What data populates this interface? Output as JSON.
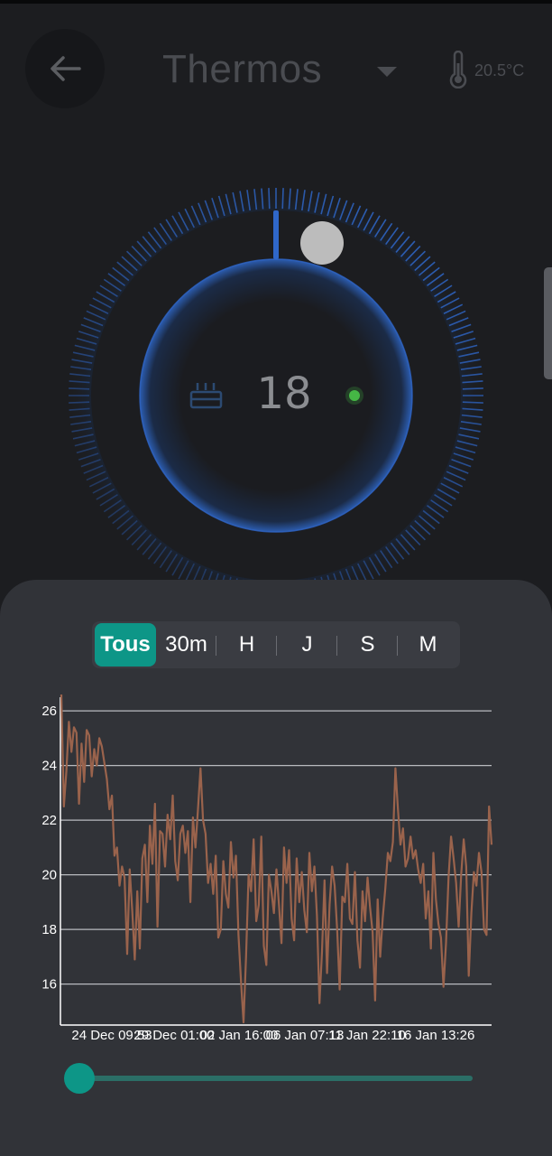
{
  "header": {
    "title": "Thermos",
    "back_icon": "arrow-left-icon",
    "dropdown_icon": "caret-down-icon",
    "thermometer_icon": "thermometer-icon",
    "external_temperature": "20.5°C"
  },
  "dial": {
    "setpoint": "18",
    "mode_icon": "radiator-icon",
    "status_dot_color": "#3fae3f",
    "accent_color": "#2f67c9"
  },
  "chart_tabs": {
    "items": [
      {
        "label": "Tous",
        "active": true
      },
      {
        "label": "30m",
        "active": false
      },
      {
        "label": "H",
        "active": false
      },
      {
        "label": "J",
        "active": false
      },
      {
        "label": "S",
        "active": false
      },
      {
        "label": "M",
        "active": false
      }
    ],
    "active_color": "#0d9687"
  },
  "chart_data": {
    "type": "line",
    "title": "",
    "xlabel": "",
    "ylabel": "",
    "ylim": [
      14.5,
      26.5
    ],
    "yticks": [
      16,
      18,
      20,
      22,
      24,
      26
    ],
    "xtick_labels": [
      "24 Dec 09:53",
      "29 Dec 01:00",
      "02 Jan 16:00",
      "06 Jan 07:13",
      "11 Jan 22:10",
      "16 Jan 13:26"
    ],
    "grid": true,
    "series": [
      {
        "name": "",
        "color": "#9a634c",
        "values": [
          26.6,
          22.5,
          23.8,
          25.6,
          24.5,
          25.4,
          25.2,
          22.6,
          24.8,
          23.4,
          25.3,
          25.1,
          23.6,
          24.6,
          24.0,
          25.0,
          24.7,
          24.1,
          23.5,
          22.4,
          22.9,
          20.7,
          21.0,
          19.6,
          20.3,
          19.9,
          17.1,
          20.2,
          18.7,
          16.9,
          19.4,
          17.3,
          20.6,
          21.1,
          19.0,
          21.8,
          20.4,
          22.6,
          18.1,
          21.6,
          21.5,
          20.3,
          22.2,
          21.3,
          22.9,
          20.5,
          19.8,
          21.5,
          21.8,
          20.8,
          21.6,
          19.0,
          22.1,
          21.0,
          22.4,
          23.9,
          22.0,
          21.5,
          19.7,
          20.4,
          19.3,
          20.7,
          17.7,
          18.0,
          20.5,
          19.3,
          18.8,
          21.2,
          19.9,
          20.7,
          17.8,
          16.1,
          14.6,
          17.0,
          20.0,
          19.4,
          21.3,
          18.3,
          18.9,
          21.4,
          17.4,
          16.7,
          20.0,
          19.4,
          18.6,
          20.2,
          18.9,
          17.5,
          21.0,
          19.7,
          20.9,
          18.4,
          17.6,
          20.6,
          19.0,
          20.1,
          18.7,
          17.9,
          20.8,
          19.4,
          20.3,
          18.5,
          15.3,
          17.2,
          19.8,
          16.4,
          18.9,
          20.3,
          19.6,
          18.0,
          15.8,
          19.2,
          19.0,
          20.4,
          18.4,
          18.2,
          20.1,
          17.6,
          16.6,
          19.4,
          18.3,
          19.9,
          18.8,
          17.9,
          15.4,
          19.1,
          17.0,
          18.4,
          19.5,
          20.8,
          20.5,
          21.2,
          23.9,
          22.4,
          21.1,
          21.7,
          20.3,
          20.6,
          21.4,
          20.6,
          20.9,
          20.2,
          19.7,
          20.4,
          18.4,
          19.4,
          17.3,
          20.8,
          19.1,
          18.2,
          17.7,
          15.9,
          17.5,
          19.9,
          21.4,
          20.6,
          19.7,
          18.1,
          20.0,
          21.3,
          20.3,
          16.3,
          18.6,
          20.1,
          19.6,
          20.8,
          20.1,
          18.0,
          17.8,
          22.5,
          21.1
        ]
      }
    ]
  },
  "range_slider": {
    "value": 0,
    "color": "#0d9687"
  }
}
